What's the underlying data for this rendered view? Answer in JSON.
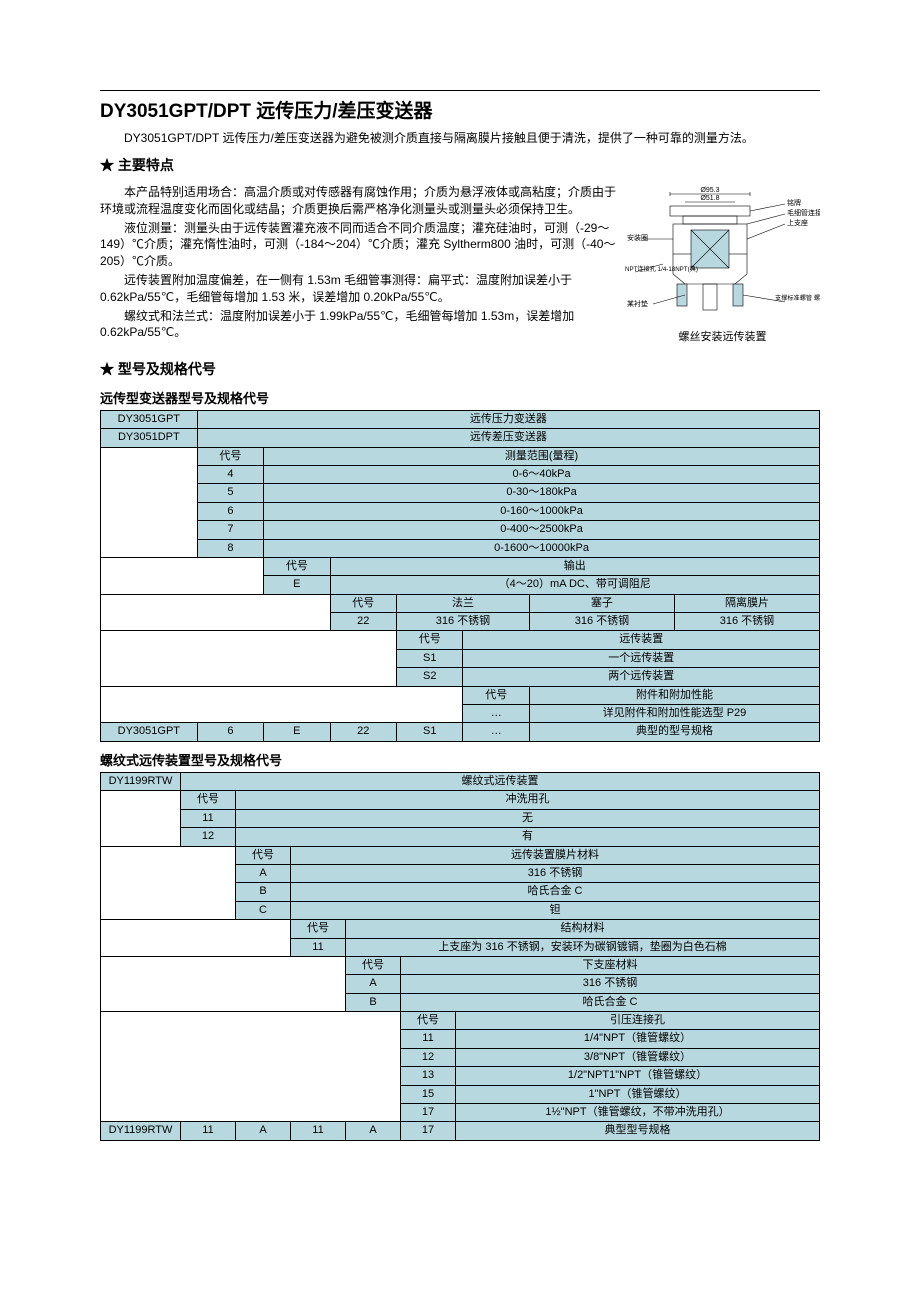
{
  "title": "DY3051GPT/DPT 远传压力/差压变送器",
  "intro": "DY3051GPT/DPT 远传压力/差压变送器为避免被测介质直接与隔离膜片接触且便于清洗，提供了一种可靠的测量方法。",
  "h2_features": "主要特点",
  "features_p1": "本产品特别适用场合：高温介质或对传感器有腐蚀作用；介质为悬浮液体或高粘度；介质由于环境或流程温度变化而固化或结晶；介质更换后需严格净化测量头或测量头必须保持卫生。",
  "features_p2": "液位测量：测量头由于远传装置灌充液不同而适合不同介质温度；灌充硅油时，可测（-29～149）℃介质；灌充惰性油时，可测（-184～204）℃介质；灌充 Syltherm800 油时，可测（-40～205）℃介质。",
  "features_p3": "远传装置附加温度偏差，在一侧有 1.53m 毛细管事测得：扁平式：温度附加误差小于 0.62kPa/55℃，毛细管每增加 1.53 米，误差增加 0.20kPa/55℃。",
  "features_p4": "螺纹式和法兰式：温度附加误差小于 1.99kPa/55℃，毛细管每增加 1.53m，误差增加 0.62kPa/55℃。",
  "fig_caption": "螺丝安装远传装置",
  "fig_labels": {
    "d953": "Ø95.3",
    "d518": "Ø51.8",
    "l1": "铭牌",
    "l2": "毛细管连接",
    "l3": "上支座",
    "l4": "安装圈",
    "l5": "NPT连接孔\n1/4-18NPT(典)",
    "l6": "某衬垫",
    "l7": "支撑标准螺管\n螺纹或承压连接"
  },
  "h2_models": "型号及规格代号",
  "h3_table1": "远传型变送器型号及规格代号",
  "t1": {
    "r0a": "DY3051GPT",
    "r0b": "远传压力变送器",
    "r1a": "DY3051DPT",
    "r1b": "远传差压变送器",
    "code": "代号",
    "range_hdr": "测量范围(量程)",
    "ranges": [
      {
        "c": "4",
        "v": "0-6～40kPa"
      },
      {
        "c": "5",
        "v": "0-30～180kPa"
      },
      {
        "c": "6",
        "v": "0-160～1000kPa"
      },
      {
        "c": "7",
        "v": "0-400～2500kPa"
      },
      {
        "c": "8",
        "v": "0-1600～10000kPa"
      }
    ],
    "out_hdr": "输出",
    "out_code": "E",
    "out_val": "（4～20）mA DC、带可调阻尼",
    "flange": "法兰",
    "plug": "塞子",
    "diaph": "隔离膜片",
    "mat_code": "22",
    "mat_val": "316 不锈钢",
    "remote_hdr": "远传装置",
    "s1": "S1",
    "s1v": "一个远传装置",
    "s2": "S2",
    "s2v": "两个远传装置",
    "acc_hdr": "附件和附加性能",
    "acc_dots": "…",
    "acc_val": "详见附件和附加性能选型 P29",
    "example_model": "DY3051GPT",
    "ex_6": "6",
    "ex_E": "E",
    "ex_22": "22",
    "ex_S1": "S1",
    "ex_dots": "…",
    "example_label": "典型的型号规格"
  },
  "h3_table2": "螺纹式远传装置型号及规格代号",
  "t2": {
    "model": "DY1199RTW",
    "model_desc": "螺纹式远传装置",
    "code": "代号",
    "flush_hdr": "冲洗用孔",
    "flush": [
      {
        "c": "11",
        "v": "无"
      },
      {
        "c": "12",
        "v": "有"
      }
    ],
    "dia_hdr": "远传装置膜片材料",
    "dia": [
      {
        "c": "A",
        "v": "316 不锈钢"
      },
      {
        "c": "B",
        "v": "哈氏合金 C"
      },
      {
        "c": "C",
        "v": "钽"
      }
    ],
    "struct_hdr": "结构材料",
    "struct_code": "11",
    "struct_val": "上支座为 316 不锈钢，安装环为碳钢镀镉，垫圈为白色石棉",
    "lower_hdr": "下支座材料",
    "lower": [
      {
        "c": "A",
        "v": "316 不锈钢"
      },
      {
        "c": "B",
        "v": "哈氏合金 C"
      }
    ],
    "conn_hdr": "引压连接孔",
    "conn": [
      {
        "c": "11",
        "v": "1/4\"NPT（锥管螺纹）"
      },
      {
        "c": "12",
        "v": "3/8\"NPT（锥管螺纹）"
      },
      {
        "c": "13",
        "v": "1/2\"NPT1\"NPT（锥管螺纹）"
      },
      {
        "c": "15",
        "v": "1\"NPT（锥管螺纹）"
      },
      {
        "c": "17",
        "v": "1½\"NPT（锥管螺纹，不带冲洗用孔）"
      }
    ],
    "example_label": "典型型号规格",
    "ex": {
      "model": "DY1199RTW",
      "a": "11",
      "b": "A",
      "c": "11",
      "d": "A",
      "e": "17"
    }
  }
}
